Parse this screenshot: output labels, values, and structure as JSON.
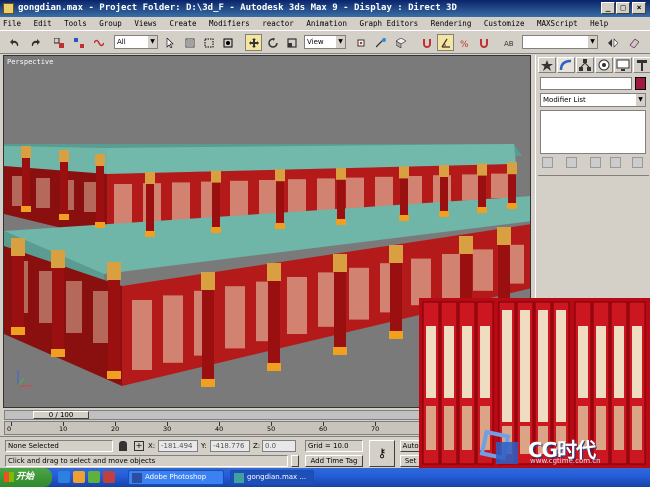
{
  "window": {
    "title": "gongdian.max    - Project Folder: D:\\3d_F    - Autodesk 3ds Max 9    - Display : Direct 3D"
  },
  "menu": [
    "File",
    "Edit",
    "Tools",
    "Group",
    "Views",
    "Create",
    "Modifiers",
    "reactor",
    "Animation",
    "Graph Editors",
    "Rendering",
    "Customize",
    "MAXScript",
    "Help"
  ],
  "toolbar": {
    "selection_filter": "All",
    "reference_coord": "View",
    "named_selection": ""
  },
  "viewport": {
    "label": "Perspective"
  },
  "command_panel": {
    "modifier_list": "Modifier List",
    "name_field": ""
  },
  "timeline": {
    "frame_counter": "0 / 100",
    "ticks": [
      "0",
      "10",
      "20",
      "30",
      "40",
      "50",
      "60",
      "70",
      "80",
      "90",
      "100"
    ]
  },
  "status": {
    "selection": "None Selected",
    "prompt": "Click and drag to select and move objects",
    "x_label": "X:",
    "x_value": "-181.494",
    "y_label": "Y:",
    "y_value": "-418.776",
    "z_label": "Z:",
    "z_value": "0.0",
    "grid": "Grid = 10.0",
    "add_time_tag": "Add Time Tag",
    "auto_key": "Auto K",
    "set_key": "Set K"
  },
  "taskbar": {
    "start": "开始",
    "tasks": [
      {
        "label": "Adobe Photoshop",
        "active": false
      },
      {
        "label": "gongdian.max ...",
        "active": true
      }
    ]
  },
  "watermark": {
    "brand": "CG时代",
    "url": "www.cgtime.com.cn"
  },
  "colors": {
    "roof": "#6fb5a8",
    "wall_red": "#b51a1a",
    "pillar_gold": "#d8a040",
    "viewport_bg": "#7a7a7a",
    "title_blue": "#0a246a"
  }
}
